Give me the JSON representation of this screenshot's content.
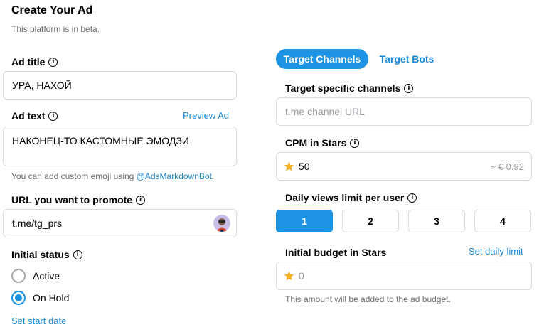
{
  "header": {
    "title": "Create Your Ad",
    "subtitle": "This platform is in beta."
  },
  "ad_title": {
    "label": "Ad title",
    "value": "УРА, НАХОЙ"
  },
  "ad_text": {
    "label": "Ad text",
    "preview_link": "Preview Ad",
    "value": "НАКОНЕЦ-ТО КАСТОМНЫЕ ЭМОДЗИ",
    "hint_prefix": "You can add custom emoji using ",
    "hint_link": "@AdsMarkdownBot",
    "hint_suffix": "."
  },
  "url": {
    "label": "URL you want to promote",
    "value": "t.me/tg_prs"
  },
  "initial_status": {
    "label": "Initial status",
    "options": [
      {
        "label": "Active",
        "selected": false
      },
      {
        "label": "On Hold",
        "selected": true
      }
    ],
    "start_date_link": "Set start date"
  },
  "tabs": [
    {
      "label": "Target Channels",
      "active": true
    },
    {
      "label": "Target Bots",
      "active": false
    }
  ],
  "target_channels": {
    "label": "Target specific channels",
    "placeholder": "t.me channel URL"
  },
  "cpm": {
    "label": "CPM in Stars",
    "value": "50",
    "converted": "~ € 0.92"
  },
  "daily_views": {
    "label": "Daily views limit per user",
    "options": [
      "1",
      "2",
      "3",
      "4"
    ],
    "selected": "1"
  },
  "budget": {
    "label": "Initial budget in Stars",
    "daily_limit_link": "Set daily limit",
    "value": "0",
    "hint": "This amount will be added to the ad budget."
  },
  "colors": {
    "accent": "#1c93e3",
    "link": "#1a8ad5",
    "border": "#dadadd",
    "muted": "#6d6d72",
    "star": "#f5b324"
  },
  "icons": [
    "info-icon",
    "star-icon",
    "avatar"
  ]
}
